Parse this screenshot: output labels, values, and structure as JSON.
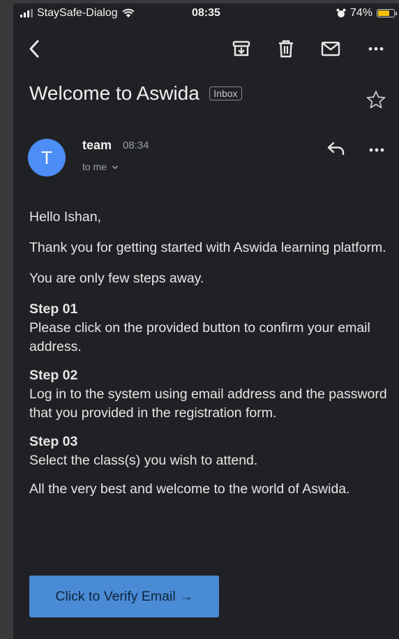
{
  "status_bar": {
    "carrier": "StaySafe-Dialog",
    "time": "08:35",
    "battery": "74%",
    "battery_level": 0.74,
    "battery_color": "#f4c20d"
  },
  "toolbar": {
    "icons": [
      "back-icon",
      "archive-icon",
      "trash-icon",
      "mail-icon",
      "more-icon"
    ]
  },
  "email": {
    "subject": "Welcome to Aswida",
    "label": "Inbox",
    "sender_initial": "T",
    "sender_name": "team",
    "sent_time": "08:34",
    "recipient": "to me",
    "avatar_color": "#4c8df6",
    "greeting": "Hello Ishan,",
    "intro": "Thank you for getting started with Aswida learning platform.",
    "steps_intro": "You are only few steps away.",
    "steps": [
      {
        "title": "Step 01",
        "text": "Please click on the provided button to confirm your email address."
      },
      {
        "title": "Step 02",
        "text": "Log in to the system using email address and the password that you provided in the registration form."
      },
      {
        "title": "Step 03",
        "text": "Select the class(s) you wish to attend."
      }
    ],
    "closing": "All the very best and welcome to the world of Aswida.",
    "button_label": "Click to Verify Email →",
    "button_color": "#4a8bd5"
  }
}
